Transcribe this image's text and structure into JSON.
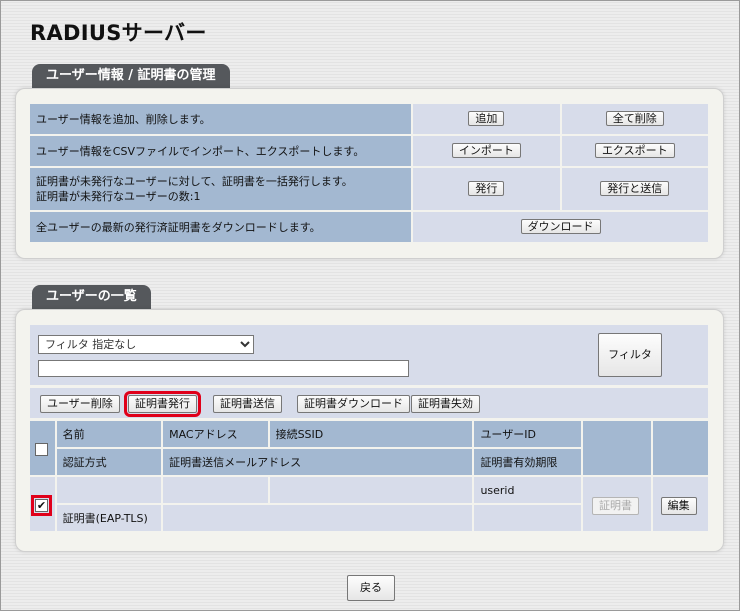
{
  "page": {
    "title": "RADIUSサーバー"
  },
  "management": {
    "tab_label": "ユーザー情報 / 証明書の管理",
    "rows": [
      {
        "desc": "ユーザー情報を追加、削除します。",
        "btn1": "追加",
        "btn2": "全て削除"
      },
      {
        "desc": "ユーザー情報をCSVファイルでインポート、エクスポートします。",
        "btn1": "インポート",
        "btn2": "エクスポート"
      },
      {
        "desc_line1": "証明書が未発行なユーザーに対して、証明書を一括発行します。",
        "desc_line2": "証明書が未発行なユーザーの数:1",
        "btn1": "発行",
        "btn2": "発行と送信"
      },
      {
        "desc": "全ユーザーの最新の発行済証明書をダウンロードします。",
        "btn1": "ダウンロード"
      }
    ]
  },
  "user_list": {
    "tab_label": "ユーザーの一覧",
    "filter": {
      "selected": "フィルタ 指定なし",
      "text_value": "",
      "button": "フィルタ"
    },
    "toolbar": {
      "delete_user": "ユーザー削除",
      "issue_cert": "証明書発行",
      "send_cert": "証明書送信",
      "download_cert": "証明書ダウンロード",
      "revoke_cert": "証明書失効"
    },
    "headers": {
      "name": "名前",
      "mac": "MACアドレス",
      "ssid": "接続SSID",
      "userid": "ユーザーID",
      "auth": "認証方式",
      "email": "証明書送信メールアドレス",
      "expiry": "証明書有効期限"
    },
    "rows": [
      {
        "checked": true,
        "name": "",
        "mac": "",
        "ssid": "",
        "userid": "userid",
        "auth": "証明書(EAP-TLS)",
        "email": "",
        "expiry": "",
        "cert_button": "証明書",
        "edit_button": "編集"
      }
    ]
  },
  "footer": {
    "back_button": "戻る"
  }
}
